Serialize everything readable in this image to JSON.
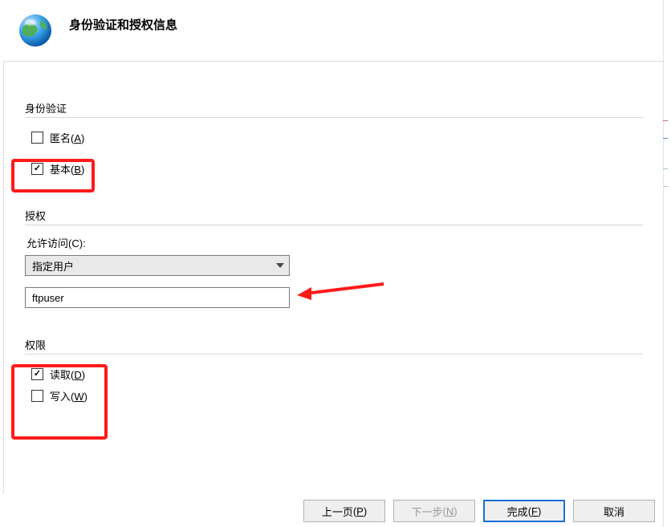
{
  "header": {
    "title": "身份验证和授权信息",
    "icon": "globe-icon"
  },
  "auth_group": {
    "legend": "身份验证",
    "anonymous": {
      "label": "匿名",
      "mnemonic": "A",
      "checked": false
    },
    "basic": {
      "label": "基本",
      "mnemonic": "B",
      "checked": true
    }
  },
  "authz_group": {
    "legend": "授权",
    "allow_access_label": "允许访问",
    "allow_access_mnemonic": "C",
    "allow_access_selected": "指定用户",
    "user_value": "ftpuser"
  },
  "perm_group": {
    "legend": "权限",
    "read": {
      "label": "读取",
      "mnemonic": "D",
      "checked": true
    },
    "write": {
      "label": "写入",
      "mnemonic": "W",
      "checked": false
    }
  },
  "buttons": {
    "prev": {
      "label": "上一页",
      "mnemonic": "P"
    },
    "next": {
      "label": "下一步",
      "mnemonic": "N",
      "disabled": true
    },
    "finish": {
      "label": "完成",
      "mnemonic": "F",
      "primary": true
    },
    "cancel": {
      "label": "取消"
    }
  },
  "watermark": ""
}
